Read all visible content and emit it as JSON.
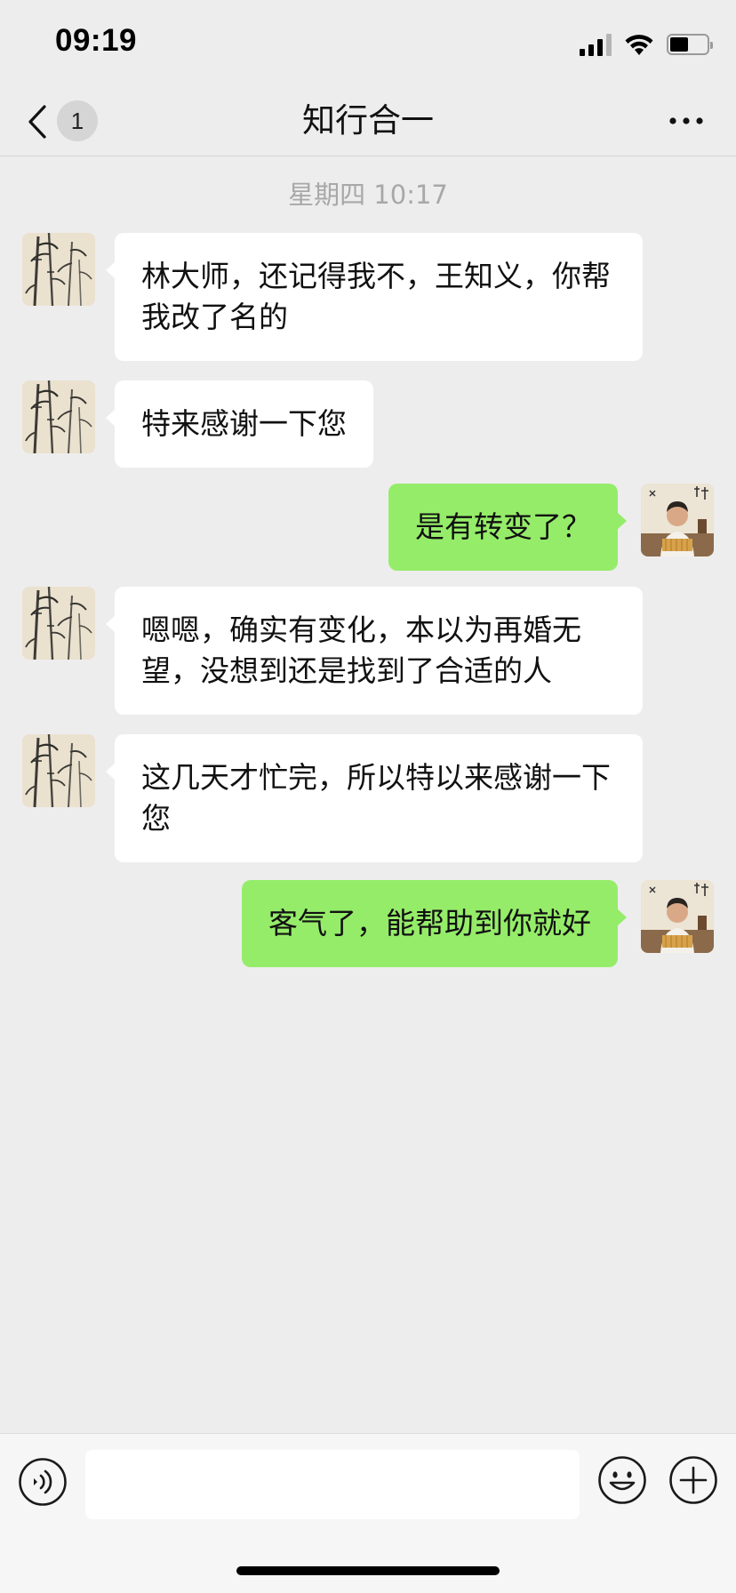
{
  "status_bar": {
    "time": "09:19",
    "battery_level": 0.5,
    "signal_bars": 3
  },
  "header": {
    "back_icon": "chevron-left-icon",
    "unread_count": "1",
    "title": "知行合一",
    "more_icon": "ellipsis-icon"
  },
  "timestamp": "星期四 10:17",
  "messages": [
    {
      "sender": "other",
      "avatar": "bamboo-painting",
      "text": "林大师，还记得我不，王知义，你帮我改了名的"
    },
    {
      "sender": "other",
      "avatar": "bamboo-painting",
      "text": "特来感谢一下您"
    },
    {
      "sender": "self",
      "avatar": "man-portrait",
      "text": "是有转变了？"
    },
    {
      "sender": "other",
      "avatar": "bamboo-painting",
      "text": "嗯嗯，确实有变化，本以为再婚无望，没想到还是找到了合适的人"
    },
    {
      "sender": "other",
      "avatar": "bamboo-painting",
      "text": "这几天才忙完，所以特以来感谢一下您"
    },
    {
      "sender": "self",
      "avatar": "man-portrait",
      "text": "客气了，能帮助到你就好"
    }
  ],
  "input_bar": {
    "voice_icon": "voice-icon",
    "input_value": "",
    "emoji_icon": "emoji-icon",
    "plus_icon": "plus-icon"
  },
  "colors": {
    "background": "#ededed",
    "bubble_self": "#95ec69",
    "bubble_other": "#ffffff",
    "timestamp": "#a8a8a8"
  }
}
